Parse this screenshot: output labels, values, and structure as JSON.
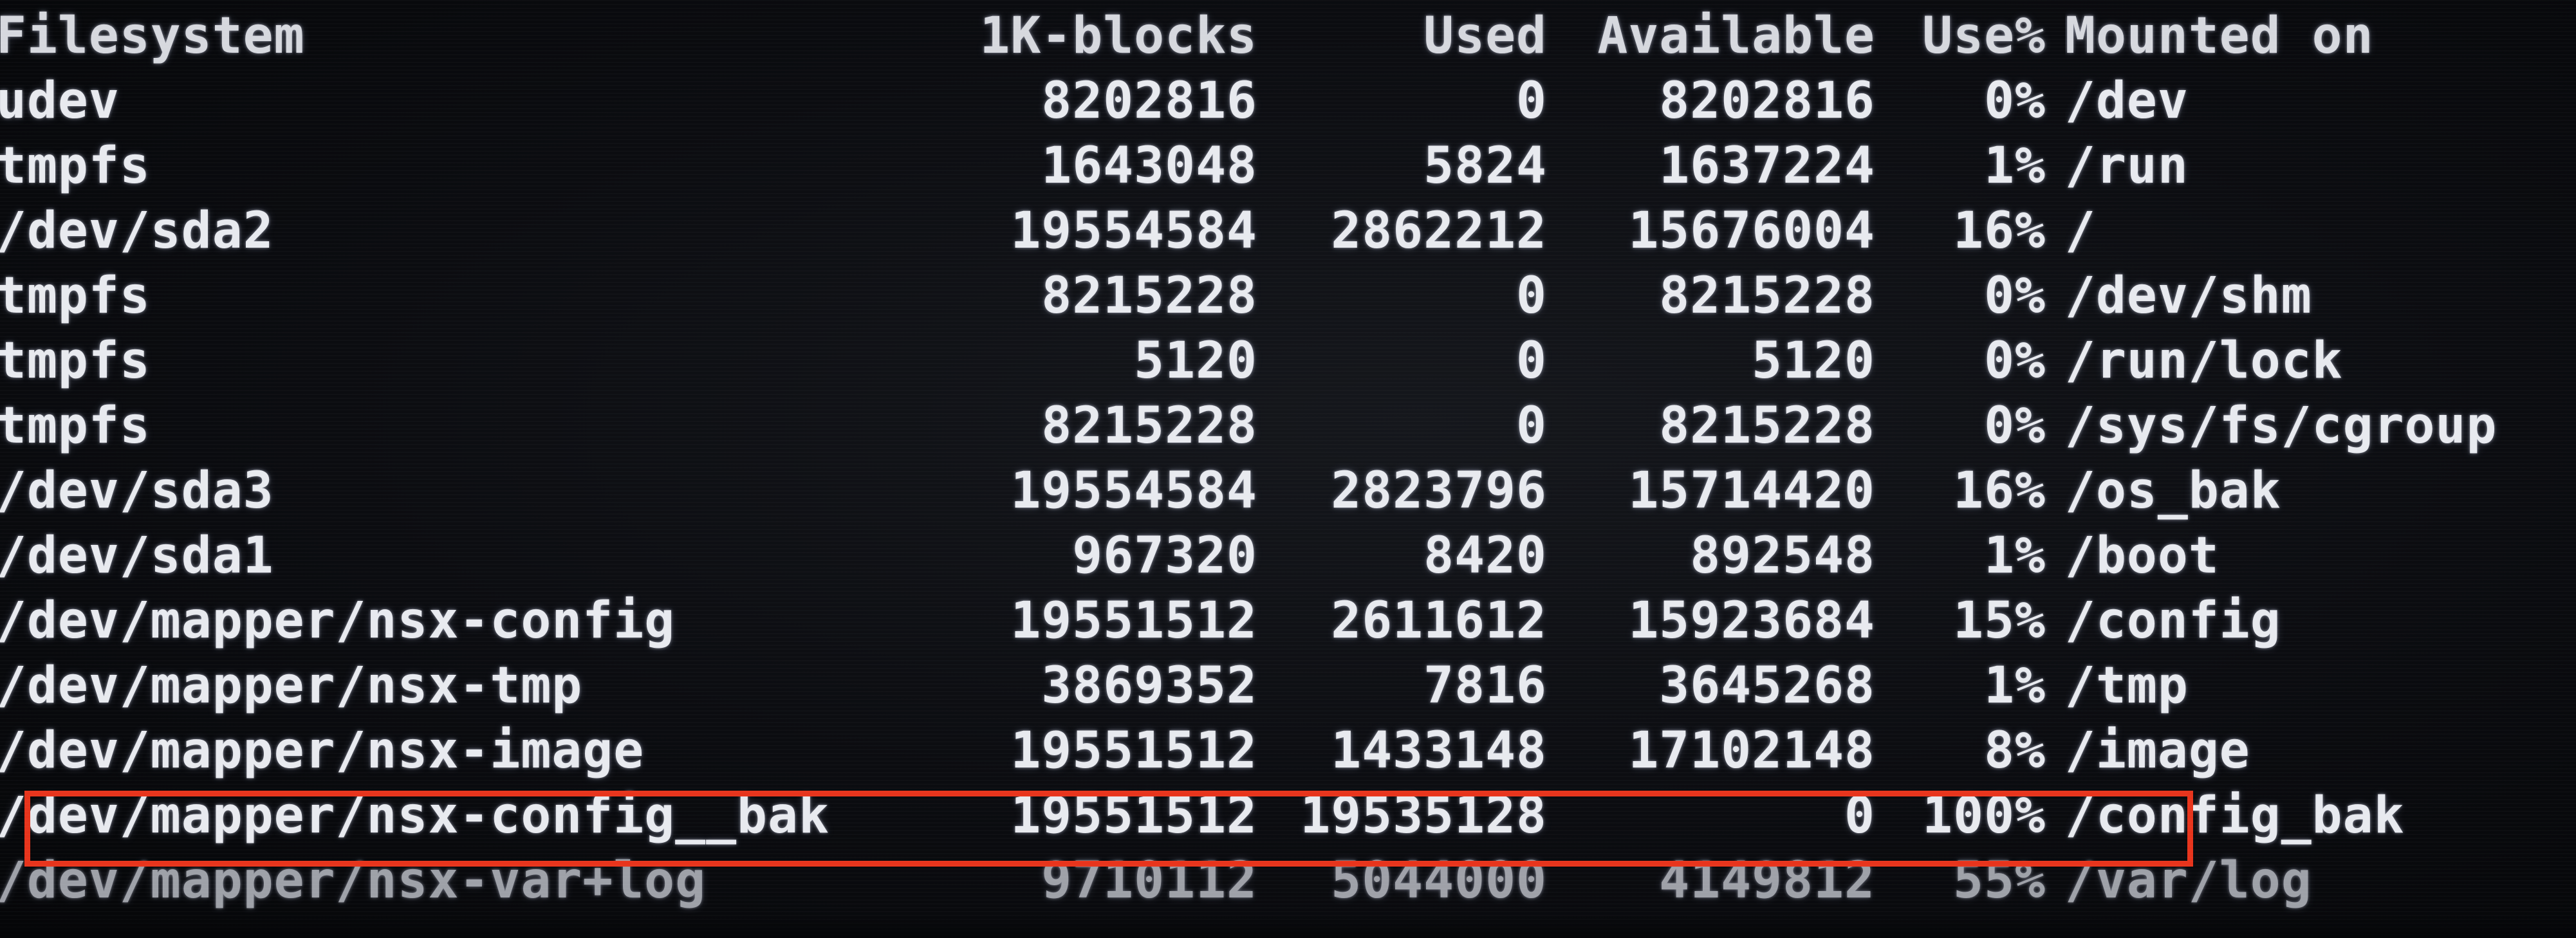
{
  "header": {
    "filesystem": "Filesystem",
    "blocks": "1K-blocks",
    "used": "Used",
    "available": "Available",
    "use_percent": "Use%",
    "mounted_on": "Mounted on"
  },
  "rows": [
    {
      "filesystem": "udev",
      "blocks": "8202816",
      "used": "0",
      "available": "8202816",
      "use_percent": "0%",
      "mounted_on": "/dev"
    },
    {
      "filesystem": "tmpfs",
      "blocks": "1643048",
      "used": "5824",
      "available": "1637224",
      "use_percent": "1%",
      "mounted_on": "/run"
    },
    {
      "filesystem": "/dev/sda2",
      "blocks": "19554584",
      "used": "2862212",
      "available": "15676004",
      "use_percent": "16%",
      "mounted_on": "/"
    },
    {
      "filesystem": "tmpfs",
      "blocks": "8215228",
      "used": "0",
      "available": "8215228",
      "use_percent": "0%",
      "mounted_on": "/dev/shm"
    },
    {
      "filesystem": "tmpfs",
      "blocks": "5120",
      "used": "0",
      "available": "5120",
      "use_percent": "0%",
      "mounted_on": "/run/lock"
    },
    {
      "filesystem": "tmpfs",
      "blocks": "8215228",
      "used": "0",
      "available": "8215228",
      "use_percent": "0%",
      "mounted_on": "/sys/fs/cgroup"
    },
    {
      "filesystem": "/dev/sda3",
      "blocks": "19554584",
      "used": "2823796",
      "available": "15714420",
      "use_percent": "16%",
      "mounted_on": "/os_bak"
    },
    {
      "filesystem": "/dev/sda1",
      "blocks": "967320",
      "used": "8420",
      "available": "892548",
      "use_percent": "1%",
      "mounted_on": "/boot"
    },
    {
      "filesystem": "/dev/mapper/nsx-config",
      "blocks": "19551512",
      "used": "2611612",
      "available": "15923684",
      "use_percent": "15%",
      "mounted_on": "/config"
    },
    {
      "filesystem": "/dev/mapper/nsx-tmp",
      "blocks": "3869352",
      "used": "7816",
      "available": "3645268",
      "use_percent": "1%",
      "mounted_on": "/tmp"
    },
    {
      "filesystem": "/dev/mapper/nsx-image",
      "blocks": "19551512",
      "used": "1433148",
      "available": "17102148",
      "use_percent": "8%",
      "mounted_on": "/image"
    },
    {
      "filesystem": "/dev/mapper/nsx-config__bak",
      "blocks": "19551512",
      "used": "19535128",
      "available": "0",
      "use_percent": "100%",
      "mounted_on": "/config_bak"
    },
    {
      "filesystem": "/dev/mapper/nsx-var+log",
      "blocks": "9710112",
      "used": "5044000",
      "available": "4149812",
      "use_percent": "55%",
      "mounted_on": "/var/log"
    }
  ],
  "colors": {
    "background": "#0b0c10",
    "text": "#e8eaef",
    "highlight_border": "#e8341c"
  }
}
